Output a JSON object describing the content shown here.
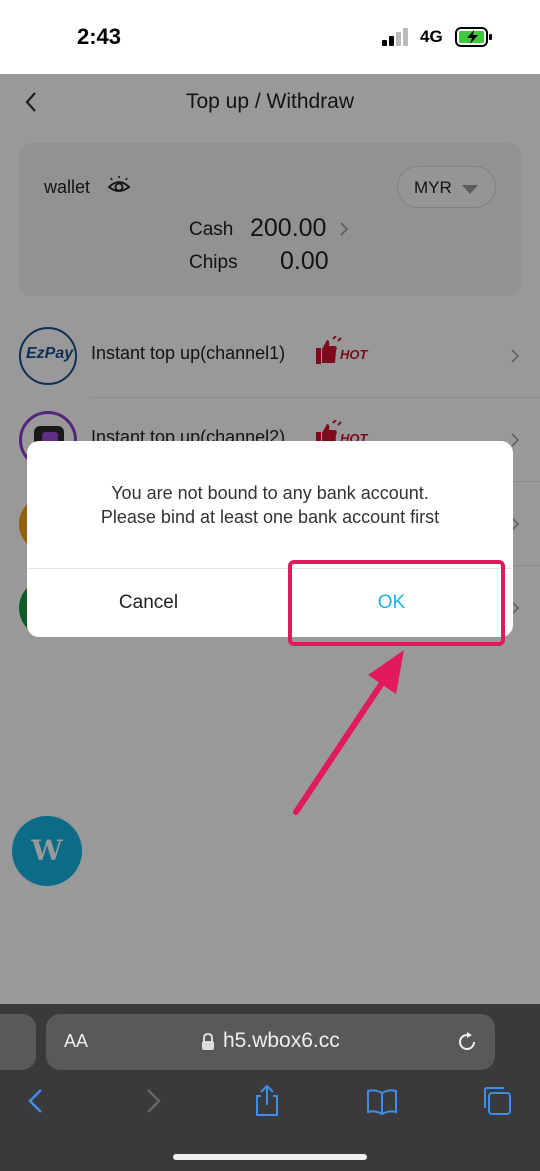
{
  "status": {
    "time": "2:43",
    "network": "4G"
  },
  "nav": {
    "title": "Top up / Withdraw"
  },
  "wallet": {
    "label": "wallet",
    "currency": "MYR",
    "cash_label": "Cash",
    "cash_value": "200.00",
    "chips_label": "Chips",
    "chips_value": "0.00"
  },
  "channels": [
    {
      "label": "Instant top up(channel1)",
      "badge": "HOT",
      "logo_text": "EzPay"
    },
    {
      "label": "Instant top up(channel2)",
      "badge": "HOT"
    },
    {
      "label": ""
    },
    {
      "label": ""
    }
  ],
  "float_button": {
    "label": "W"
  },
  "dialog": {
    "message_line1": "You are not bound to any bank account.",
    "message_line2": "Please bind at least one bank account first",
    "cancel_label": "Cancel",
    "ok_label": "OK"
  },
  "browser": {
    "aa_label": "AA",
    "url": "h5.wbox6.cc"
  },
  "colors": {
    "accent": "#1ab3e6",
    "annotation": "#e2195b",
    "hot": "#d8102e",
    "browser_bar": "#3a3a3c"
  },
  "icons": [
    "back-icon",
    "eye-icon",
    "chevron-right-icon",
    "lock-icon",
    "reload-icon",
    "share-icon",
    "bookmarks-icon",
    "tabs-icon"
  ]
}
